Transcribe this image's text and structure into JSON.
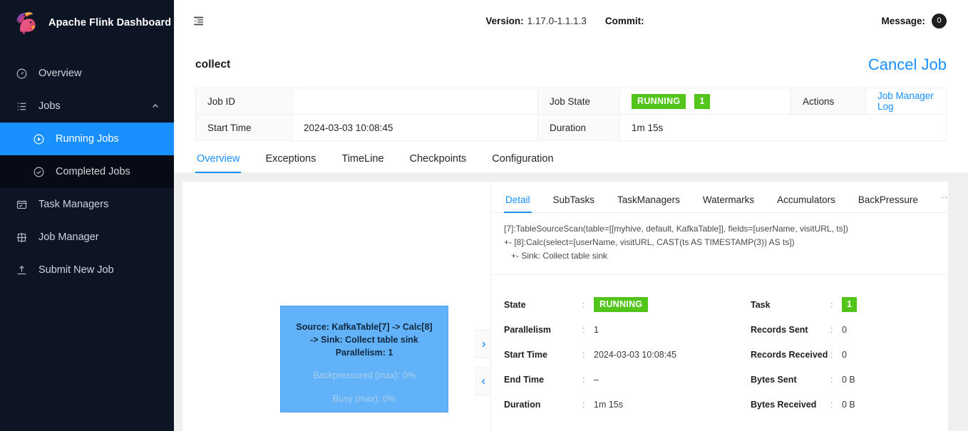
{
  "brand": {
    "title": "Apache Flink Dashboard",
    "logo_icon": "flink-squirrel-logo"
  },
  "sidebar": {
    "items": [
      {
        "label": "Overview",
        "icon": "dashboard-icon"
      },
      {
        "label": "Jobs",
        "icon": "list-icon",
        "caret": "chevron-up-icon"
      },
      {
        "label": "Running Jobs",
        "icon": "play-circle-icon"
      },
      {
        "label": "Completed Jobs",
        "icon": "check-circle-icon"
      },
      {
        "label": "Task Managers",
        "icon": "task-managers-icon"
      },
      {
        "label": "Job Manager",
        "icon": "job-manager-icon"
      },
      {
        "label": "Submit New Job",
        "icon": "upload-icon"
      }
    ]
  },
  "topbar": {
    "fold_icon": "menu-fold-icon",
    "version_label": "Version:",
    "version_value": "1.17.0-1.1.1.3",
    "commit_label": "Commit:",
    "commit_value": "",
    "message_label": "Message:",
    "message_count": "0"
  },
  "job": {
    "name": "collect",
    "cancel_label": "Cancel Job",
    "table": {
      "job_id_label": "Job ID",
      "job_id_value": "",
      "job_state_label": "Job State",
      "job_state_value": "RUNNING",
      "job_state_count": "1",
      "actions_label": "Actions",
      "actions_link": "Job Manager Log",
      "start_time_label": "Start Time",
      "start_time_value": "2024-03-03 10:08:45",
      "duration_label": "Duration",
      "duration_value": "1m 15s"
    },
    "tabs": [
      {
        "label": "Overview"
      },
      {
        "label": "Exceptions"
      },
      {
        "label": "TimeLine"
      },
      {
        "label": "Checkpoints"
      },
      {
        "label": "Configuration"
      }
    ],
    "active_tab": "Overview"
  },
  "graph": {
    "node": {
      "title_line1": "Source: KafkaTable[7] -> Calc[8]",
      "title_line2": "-> Sink: Collect table sink",
      "title_line3": "Parallelism: 1",
      "sub_line1": "Backpressured (max): 0%",
      "sub_line2": "Busy (max): 0%",
      "color": "#62b2fa"
    },
    "expand_icon": "chevron-right-icon",
    "collapse_icon": "chevron-left-icon"
  },
  "detail": {
    "tabs": [
      {
        "label": "Detail"
      },
      {
        "label": "SubTasks"
      },
      {
        "label": "TaskManagers"
      },
      {
        "label": "Watermarks"
      },
      {
        "label": "Accumulators"
      },
      {
        "label": "BackPressure"
      }
    ],
    "active_tab": "Detail",
    "more_label": "···",
    "plan_text": "[7]:TableSourceScan(table=[[myhive, default, KafkaTable]], fields=[userName, visitURL, ts])\n+- [8]:Calc(select=[userName, visitURL, CAST(ts AS TIMESTAMP(3)) AS ts])\n   +- Sink: Collect table sink",
    "separator": ":",
    "left_rows": [
      {
        "key": "State",
        "value": "RUNNING",
        "type": "tag-green"
      },
      {
        "key": "Parallelism",
        "value": "1",
        "type": "text"
      },
      {
        "key": "Start Time",
        "value": "2024-03-03 10:08:45",
        "type": "text"
      },
      {
        "key": "End Time",
        "value": "–",
        "type": "text"
      },
      {
        "key": "Duration",
        "value": "1m 15s",
        "type": "text"
      }
    ],
    "right_rows": [
      {
        "key": "Task",
        "value": "1",
        "type": "tag-green"
      },
      {
        "key": "Records Sent",
        "value": "0",
        "type": "text"
      },
      {
        "key": "Records Received",
        "value": "0",
        "type": "text"
      },
      {
        "key": "Bytes Sent",
        "value": "0 B",
        "type": "text"
      },
      {
        "key": "Bytes Received",
        "value": "0 B",
        "type": "text"
      }
    ]
  },
  "colors": {
    "accent": "#1890ff",
    "success": "#52c41a",
    "sidebar_bg": "#0d1424",
    "sidebar_sub_bg": "#060b16",
    "node_blue": "#62b2fa"
  }
}
